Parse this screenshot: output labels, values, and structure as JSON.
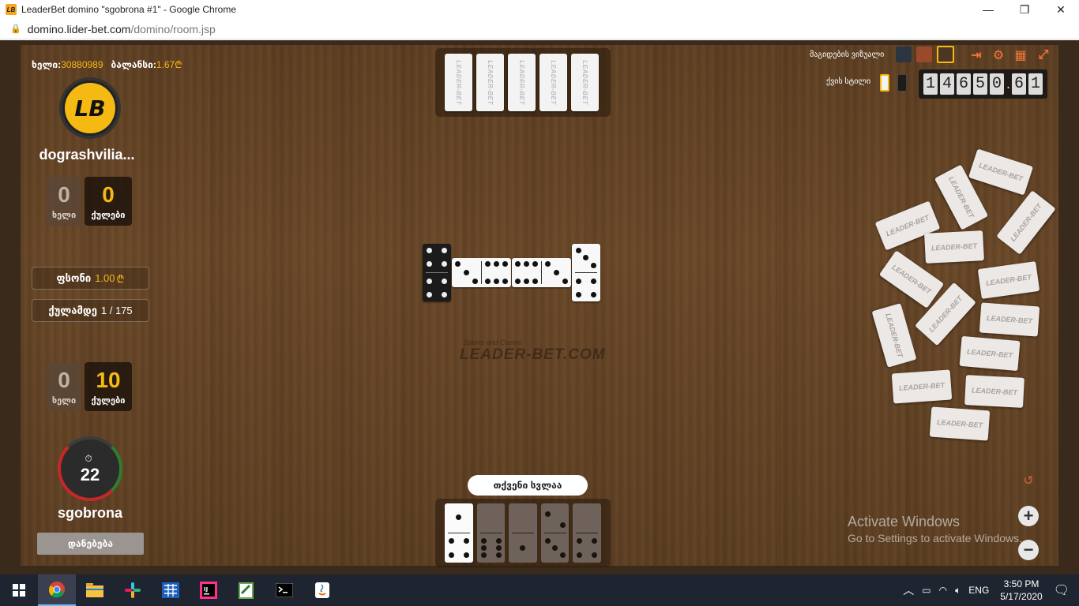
{
  "browser": {
    "title": "LeaderBet domino \"sgobrona #1\" - Google Chrome",
    "favicon_text": "LB",
    "url_host": "domino.lider-bet.com",
    "url_path": "/domino/room.jsp",
    "minimize": "—",
    "maximize": "❐",
    "close": "✕"
  },
  "header": {
    "hand_label": "ხელი:",
    "hand_value": "30880989",
    "balance_label": "ბალანსი:",
    "balance_value": "1.67",
    "currency": "₾"
  },
  "opponent": {
    "name": "dograshvilia...",
    "logo": "LB",
    "hands": "0",
    "hands_label": "ხელი",
    "points": "0",
    "points_label": "ქულები"
  },
  "game_info": {
    "stake_label": "ფსონი",
    "stake_value": "1.00",
    "target_label": "ქულამდე",
    "target_value": "1 / 175"
  },
  "player": {
    "name": "sgobrona",
    "hands": "0",
    "hands_label": "ხელი",
    "points": "10",
    "points_label": "ქულები",
    "timer": "22",
    "timer_icon": "⏱",
    "leave_label": "დანებება"
  },
  "table": {
    "turn_label": "თქვენი სვლაა",
    "watermark_sub": "Sports and Casino",
    "watermark": "LEADER-BET.COM",
    "tile_back_text": "LEADER-BET"
  },
  "top_right": {
    "theme_label": "მაგიდების ვიზუალი",
    "table_label": "ქვის სტილი",
    "jackpot_digits": [
      "1",
      "4",
      "6",
      "5",
      "0",
      "6",
      "1"
    ],
    "jackpot_sep": ".",
    "icons": [
      "exit-icon",
      "gear-icon",
      "grid-icon",
      "fullscreen-icon"
    ]
  },
  "controls": {
    "undo": "↺",
    "zoom_in": "+",
    "zoom_out": "−"
  },
  "watermark_os": {
    "title": "Activate Windows",
    "subtitle": "Go to Settings to activate Windows."
  },
  "taskbar": {
    "time": "3:50 PM",
    "date": "5/17/2020",
    "lang": "ENG"
  }
}
